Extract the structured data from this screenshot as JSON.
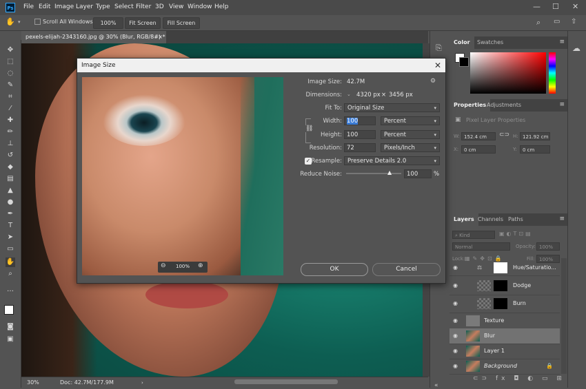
{
  "menubar": {
    "app_icon": "Ps",
    "items": [
      "File",
      "Edit",
      "Image",
      "Layer",
      "Type",
      "Select",
      "Filter",
      "3D",
      "View",
      "Window",
      "Help"
    ],
    "window_controls": [
      "—",
      "☐",
      "✕"
    ]
  },
  "options": {
    "scroll_all_windows": "Scroll All Windows",
    "zoom_btn": "100%",
    "fit_screen": "Fit Screen",
    "fill_screen": "Fill Screen"
  },
  "document": {
    "tab_title": "pexels-elijah-2343160.jpg @ 30% (Blur, RGB/8#) *",
    "tab_close": "×",
    "status_zoom": "30%",
    "status_doc": "Doc: 42.7M/177.9M"
  },
  "panels": {
    "color_tab": "Color",
    "swatches_tab": "Swatches",
    "properties_tab": "Properties",
    "adjustments_tab": "Adjustments",
    "pixel_layer_props": "Pixel Layer Properties",
    "w_label": "W:",
    "w_value": "152.4 cm",
    "h_label": "H:",
    "h_value": "121.92 cm",
    "x_label": "X:",
    "x_value": "0 cm",
    "y_label": "Y:",
    "y_value": "0 cm",
    "layers_tab": "Layers",
    "channels_tab": "Channels",
    "paths_tab": "Paths",
    "kind": "Kind",
    "blend_mode": "Normal",
    "opacity_label": "Opacity:",
    "opacity_value": "100%",
    "lock_label": "Lock:",
    "fill_label": "Fill:",
    "fill_value": "100%",
    "layers": [
      {
        "name": "Hue/Saturatio..."
      },
      {
        "name": "Dodge"
      },
      {
        "name": "Burn"
      },
      {
        "name": "Texture"
      },
      {
        "name": "Blur"
      },
      {
        "name": "Layer 1"
      },
      {
        "name": "Background"
      }
    ]
  },
  "dialog": {
    "title": "Image Size",
    "image_size_label": "Image Size:",
    "image_size_value": "42.7M",
    "dimensions_label": "Dimensions:",
    "dimensions_w": "4320 px",
    "dimensions_x": "×",
    "dimensions_h": "3456 px",
    "fit_to_label": "Fit To:",
    "fit_to_value": "Original Size",
    "width_label": "Width:",
    "width_value": "100",
    "width_unit": "Percent",
    "height_label": "Height:",
    "height_value": "100",
    "height_unit": "Percent",
    "resolution_label": "Resolution:",
    "resolution_value": "72",
    "resolution_unit": "Pixels/Inch",
    "resample_label": "Resample:",
    "resample_value": "Preserve Details 2.0",
    "reduce_noise_label": "Reduce Noise:",
    "reduce_noise_value": "100",
    "reduce_noise_unit": "%",
    "preview_zoom": "100%",
    "ok": "OK",
    "cancel": "Cancel"
  }
}
